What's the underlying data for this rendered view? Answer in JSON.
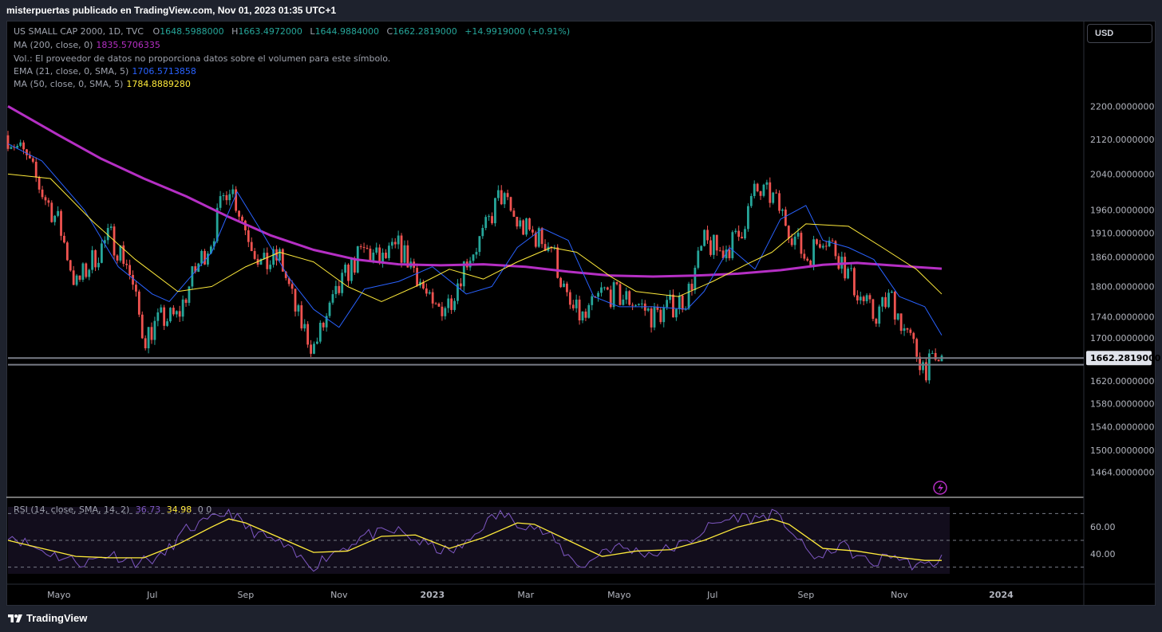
{
  "header": {
    "title": "misterpuertas publicado en TradingView.com, Nov 01, 2023 01:35 UTC+1"
  },
  "toolbar": {
    "currency": "USD"
  },
  "legend": {
    "symbol": "US SMALL CAP 2000, 1D, TVC",
    "o_label": "O",
    "o": "1648.5988000",
    "h_label": "H",
    "h": "1663.4972000",
    "l_label": "L",
    "l": "1644.9884000",
    "c_label": "C",
    "c": "1662.2819000",
    "change": "+14.9919000 (+0.91%)",
    "ma200_label": "MA (200, close, 0)",
    "ma200": "1835.5706335",
    "vol_note": "Vol.: El proveedor de datos no proporciona datos sobre el volumen para este símbolo.",
    "ema21_label": "EMA (21, close, 0, SMA, 5)",
    "ema21": "1706.5713858",
    "ma50_label": "MA (50, close, 0, SMA, 5)",
    "ma50": "1784.8889280",
    "rsi_label": "RSI (14, close, SMA, 14, 2)",
    "rsi": "36.73",
    "rsi_ma": "34.98",
    "rsi_extra": "0  0"
  },
  "price_axis": [
    "2200.0000000",
    "2120.0000000",
    "2040.0000000",
    "1960.0000000",
    "1910.0000000",
    "1860.0000000",
    "1800.0000000",
    "1740.0000000",
    "1700.0000000",
    "1620.0000000",
    "1580.0000000",
    "1540.0000000",
    "1500.0000000",
    "1464.0000000"
  ],
  "last_price": "1662.2819000",
  "rsi_axis": [
    "60.00",
    "40.00"
  ],
  "time_axis": [
    "Mayo",
    "Jul",
    "Sep",
    "Nov",
    "2023",
    "Mar",
    "Mayo",
    "Jul",
    "Sep",
    "Nov",
    "2024"
  ],
  "footer": {
    "brand": "TradingView"
  },
  "colors": {
    "up": "#26a69a",
    "down": "#ef5350",
    "ma200": "#b52fc4",
    "ema21": "#2962ff",
    "ma50": "#ffeb3b",
    "rsi": "#7e57c2",
    "rsi_ma": "#ffeb3b",
    "support": "#787b86"
  },
  "chart_data": [
    {
      "type": "line",
      "title": "US SMALL CAP 2000, 1D, TVC",
      "x_ticks": [
        "Mayo",
        "Jul",
        "Sep",
        "Nov",
        "2023",
        "Mar",
        "Mayo",
        "Jul",
        "Sep",
        "Nov",
        "2024"
      ],
      "y_scale": "log",
      "ylim": [
        1440,
        2250
      ],
      "series": [
        {
          "name": "MA (200, close, 0)",
          "color": "#b52fc4",
          "points": [
            [
              0,
              2200
            ],
            [
              6,
              2130
            ],
            [
              11,
              2075
            ],
            [
              16,
              2030
            ],
            [
              21,
              1990
            ],
            [
              26,
              1945
            ],
            [
              31,
              1905
            ],
            [
              36,
              1875
            ],
            [
              41,
              1855
            ],
            [
              46,
              1845
            ],
            [
              51,
              1843
            ],
            [
              56,
              1845
            ],
            [
              61,
              1840
            ],
            [
              66,
              1830
            ],
            [
              71,
              1822
            ],
            [
              76,
              1820
            ],
            [
              81,
              1822
            ],
            [
              86,
              1826
            ],
            [
              91,
              1833
            ],
            [
              96,
              1844
            ],
            [
              100,
              1848
            ],
            [
              104,
              1843
            ],
            [
              110,
              1836
            ]
          ]
        },
        {
          "name": "EMA (21, close, 0, SMA, 5)",
          "color": "#2962ff",
          "points": [
            [
              0,
              2110
            ],
            [
              4,
              2070
            ],
            [
              9,
              1960
            ],
            [
              13,
              1840
            ],
            [
              17,
              1785
            ],
            [
              19,
              1770
            ],
            [
              24,
              1870
            ],
            [
              27,
              2000
            ],
            [
              30,
              1910
            ],
            [
              33,
              1820
            ],
            [
              36,
              1755
            ],
            [
              39,
              1720
            ],
            [
              42,
              1795
            ],
            [
              46,
              1810
            ],
            [
              50,
              1840
            ],
            [
              54,
              1785
            ],
            [
              57,
              1800
            ],
            [
              60,
              1880
            ],
            [
              63,
              1920
            ],
            [
              66,
              1895
            ],
            [
              69,
              1780
            ],
            [
              72,
              1760
            ],
            [
              76,
              1760
            ],
            [
              80,
              1755
            ],
            [
              82,
              1790
            ],
            [
              85,
              1880
            ],
            [
              88,
              1835
            ],
            [
              91,
              1940
            ],
            [
              94,
              1970
            ],
            [
              96,
              1895
            ],
            [
              99,
              1880
            ],
            [
              102,
              1855
            ],
            [
              105,
              1780
            ],
            [
              108,
              1760
            ],
            [
              110,
              1705
            ]
          ]
        },
        {
          "name": "MA (50, close, 0, SMA, 5)",
          "color": "#ffeb3b",
          "points": [
            [
              0,
              2040
            ],
            [
              5,
              2030
            ],
            [
              10,
              1935
            ],
            [
              15,
              1855
            ],
            [
              20,
              1790
            ],
            [
              24,
              1800
            ],
            [
              28,
              1840
            ],
            [
              32,
              1870
            ],
            [
              36,
              1850
            ],
            [
              40,
              1800
            ],
            [
              44,
              1770
            ],
            [
              48,
              1800
            ],
            [
              52,
              1835
            ],
            [
              56,
              1815
            ],
            [
              60,
              1850
            ],
            [
              64,
              1880
            ],
            [
              67,
              1870
            ],
            [
              71,
              1820
            ],
            [
              74,
              1790
            ],
            [
              79,
              1780
            ],
            [
              83,
              1810
            ],
            [
              87,
              1845
            ],
            [
              90,
              1870
            ],
            [
              94,
              1930
            ],
            [
              99,
              1925
            ],
            [
              103,
              1880
            ],
            [
              107,
              1835
            ],
            [
              110,
              1785
            ]
          ]
        },
        {
          "name": "Close",
          "color": "#26a69a",
          "points": [
            [
              0,
              2130
            ],
            [
              2,
              2080
            ],
            [
              4,
              2000
            ],
            [
              6,
              1930
            ],
            [
              8,
              1800
            ],
            [
              10,
              1855
            ],
            [
              12,
              1905
            ],
            [
              14,
              1850
            ],
            [
              16,
              1700
            ],
            [
              18,
              1735
            ],
            [
              20,
              1740
            ],
            [
              22,
              1830
            ],
            [
              24,
              1900
            ],
            [
              26,
              2025
            ],
            [
              28,
              1920
            ],
            [
              30,
              1840
            ],
            [
              32,
              1860
            ],
            [
              34,
              1745
            ],
            [
              36,
              1680
            ],
            [
              38,
              1755
            ],
            [
              40,
              1830
            ],
            [
              42,
              1875
            ],
            [
              44,
              1850
            ],
            [
              46,
              1880
            ],
            [
              48,
              1835
            ],
            [
              50,
              1750
            ],
            [
              52,
              1770
            ],
            [
              54,
              1855
            ],
            [
              56,
              1905
            ],
            [
              58,
              1995
            ],
            [
              60,
              1930
            ],
            [
              62,
              1905
            ],
            [
              64,
              1885
            ],
            [
              66,
              1760
            ],
            [
              68,
              1735
            ],
            [
              70,
              1790
            ],
            [
              72,
              1780
            ],
            [
              74,
              1770
            ],
            [
              76,
              1740
            ],
            [
              78,
              1760
            ],
            [
              80,
              1780
            ],
            [
              82,
              1890
            ],
            [
              84,
              1870
            ],
            [
              86,
              1900
            ],
            [
              88,
              2000
            ],
            [
              90,
              1990
            ],
            [
              92,
              1925
            ],
            [
              94,
              1855
            ],
            [
              96,
              1910
            ],
            [
              98,
              1860
            ],
            [
              100,
              1790
            ],
            [
              102,
              1740
            ],
            [
              104,
              1780
            ],
            [
              106,
              1700
            ],
            [
              108,
              1645
            ],
            [
              109,
              1650
            ],
            [
              110,
              1662
            ]
          ]
        }
      ],
      "horizontal_lines": [
        1662.28,
        1650
      ]
    },
    {
      "type": "line",
      "title": "RSI (14, close, SMA, 14, 2)",
      "ylim": [
        25,
        75
      ],
      "bands": [
        70,
        50,
        30
      ],
      "series": [
        {
          "name": "RSI",
          "color": "#7e57c2",
          "points": [
            [
              0,
              55
            ],
            [
              3,
              45
            ],
            [
              6,
              38
            ],
            [
              9,
              33
            ],
            [
              12,
              40
            ],
            [
              15,
              34
            ],
            [
              18,
              37
            ],
            [
              21,
              58
            ],
            [
              24,
              65
            ],
            [
              26,
              72
            ],
            [
              28,
              60
            ],
            [
              30,
              53
            ],
            [
              32,
              48
            ],
            [
              34,
              38
            ],
            [
              36,
              31
            ],
            [
              38,
              40
            ],
            [
              40,
              46
            ],
            [
              42,
              54
            ],
            [
              44,
              55
            ],
            [
              46,
              57
            ],
            [
              48,
              50
            ],
            [
              50,
              45
            ],
            [
              52,
              41
            ],
            [
              54,
              47
            ],
            [
              56,
              62
            ],
            [
              58,
              70
            ],
            [
              60,
              64
            ],
            [
              62,
              60
            ],
            [
              64,
              52
            ],
            [
              66,
              38
            ],
            [
              68,
              30
            ],
            [
              70,
              43
            ],
            [
              72,
              45
            ],
            [
              74,
              42
            ],
            [
              76,
              40
            ],
            [
              78,
              44
            ],
            [
              80,
              48
            ],
            [
              82,
              58
            ],
            [
              84,
              64
            ],
            [
              86,
              68
            ],
            [
              88,
              66
            ],
            [
              90,
              70
            ],
            [
              92,
              60
            ],
            [
              94,
              42
            ],
            [
              96,
              36
            ],
            [
              98,
              48
            ],
            [
              100,
              38
            ],
            [
              102,
              32
            ],
            [
              104,
              40
            ],
            [
              106,
              33
            ],
            [
              108,
              30
            ],
            [
              110,
              37
            ]
          ]
        },
        {
          "name": "RSI MA",
          "color": "#ffeb3b",
          "points": [
            [
              0,
              50
            ],
            [
              4,
              44
            ],
            [
              8,
              38
            ],
            [
              12,
              37
            ],
            [
              16,
              37
            ],
            [
              20,
              47
            ],
            [
              24,
              60
            ],
            [
              26,
              66
            ],
            [
              28,
              63
            ],
            [
              32,
              52
            ],
            [
              36,
              41
            ],
            [
              40,
              42
            ],
            [
              44,
              53
            ],
            [
              48,
              54
            ],
            [
              52,
              44
            ],
            [
              56,
              52
            ],
            [
              60,
              63
            ],
            [
              62,
              62
            ],
            [
              66,
              50
            ],
            [
              70,
              38
            ],
            [
              74,
              42
            ],
            [
              78,
              43
            ],
            [
              82,
              50
            ],
            [
              86,
              60
            ],
            [
              90,
              66
            ],
            [
              92,
              62
            ],
            [
              96,
              44
            ],
            [
              100,
              42
            ],
            [
              104,
              38
            ],
            [
              108,
              35
            ],
            [
              110,
              35
            ]
          ]
        }
      ]
    }
  ]
}
